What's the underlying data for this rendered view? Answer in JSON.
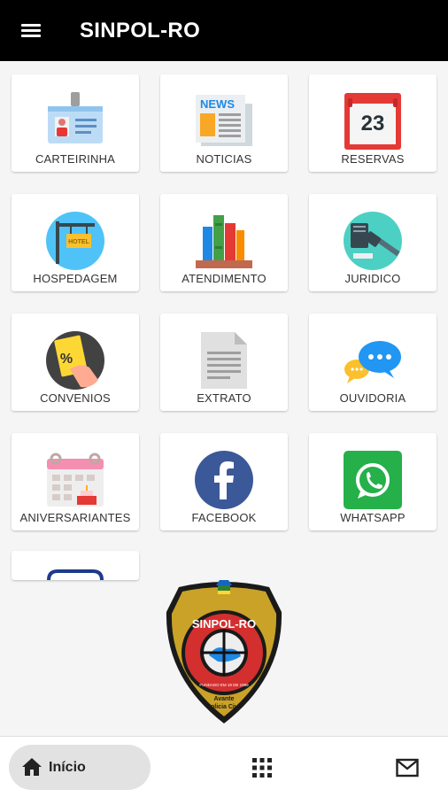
{
  "app": {
    "title": "SINPOL-RO"
  },
  "tiles": [
    {
      "label": "CARTEIRINHA",
      "icon": "id-card-icon"
    },
    {
      "label": "NOTICIAS",
      "icon": "newspaper-icon"
    },
    {
      "label": "RESERVAS",
      "icon": "calendar-icon",
      "day": "23"
    },
    {
      "label": "HOSPEDAGEM",
      "icon": "hotel-sign-icon",
      "sign": "HOTEL"
    },
    {
      "label": "ATENDIMENTO",
      "icon": "books-icon"
    },
    {
      "label": "JURIDICO",
      "icon": "gavel-icon"
    },
    {
      "label": "CONVENIOS",
      "icon": "discount-coupon-icon"
    },
    {
      "label": "EXTRATO",
      "icon": "document-icon"
    },
    {
      "label": "OUVIDORIA",
      "icon": "chat-bubbles-icon"
    },
    {
      "label": "ANIVERSARIANTES",
      "icon": "birthday-calendar-icon"
    },
    {
      "label": "FACEBOOK",
      "icon": "facebook-icon"
    },
    {
      "label": "WHATSAPP",
      "icon": "whatsapp-icon"
    }
  ],
  "news_icon_text": "NEWS",
  "emblem": {
    "name": "SINPOL-RO",
    "founded": "FUNDADO EM 19 DE 1989",
    "motto": "Avante",
    "subtitle": "Policia Civil"
  },
  "bottom_nav": {
    "home_label": "Início",
    "home_icon": "home-icon",
    "grid_icon": "apps-grid-icon",
    "mail_icon": "mail-icon"
  },
  "colors": {
    "appbar": "#000000",
    "accent_gold": "#c9a227",
    "nav_active": "#e2e2e2"
  }
}
